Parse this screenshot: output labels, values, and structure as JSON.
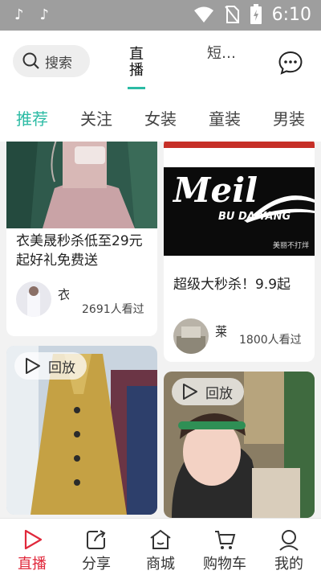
{
  "status_bar": {
    "time": "6:10",
    "left_icons": [
      "tiktok-icon",
      "tiktok-icon"
    ],
    "right_icons": [
      "wifi-icon",
      "no-sim-icon",
      "battery-icon"
    ]
  },
  "header": {
    "search_label": "搜索",
    "tab_live": "直播",
    "tab_short": "短…",
    "message_icon": "chat-bubble-icon",
    "accent_color": "#2bbba4"
  },
  "categories": [
    "推荐",
    "关注",
    "女装",
    "童装",
    "男装"
  ],
  "active_category": "推荐",
  "feed": {
    "cards": [
      {
        "title": "衣美晟秒杀低至29元起好礼免费送",
        "name": "衣…",
        "viewers": "2691人看过"
      },
      {
        "banner_text": "Meil",
        "banner_sub": "BU DA YANG",
        "banner_small": "美丽不打烊",
        "title": "超级大秒杀！9.9起",
        "name": "莱…",
        "viewers": "1800人看过"
      },
      {
        "badge": "回放"
      },
      {
        "badge": "回放"
      }
    ]
  },
  "bottom_nav": [
    {
      "label": "直播",
      "icon": "play-icon",
      "active": true
    },
    {
      "label": "分享",
      "icon": "share-icon",
      "active": false
    },
    {
      "label": "商城",
      "icon": "store-icon",
      "active": false
    },
    {
      "label": "购物车",
      "icon": "cart-icon",
      "active": false
    },
    {
      "label": "我的",
      "icon": "profile-icon",
      "active": false
    }
  ],
  "colors": {
    "accent": "#2bbba4",
    "nav_active": "#e0283b"
  }
}
